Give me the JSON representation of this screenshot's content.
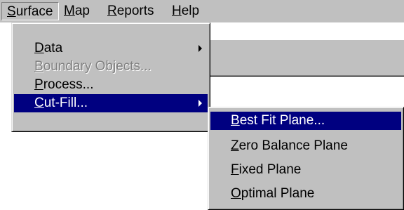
{
  "menubar": {
    "items": [
      {
        "accel": "S",
        "rest": "urface"
      },
      {
        "accel": "M",
        "rest": "ap"
      },
      {
        "accel": "R",
        "rest": "eports"
      },
      {
        "accel": "H",
        "rest": "elp"
      }
    ]
  },
  "surface_menu": {
    "items": [
      {
        "accel": "D",
        "rest": "ata",
        "has_submenu": true
      },
      {
        "accel": "B",
        "rest": "oundary Objects...",
        "disabled": true
      },
      {
        "accel": "P",
        "rest": "rocess..."
      },
      {
        "accel": "C",
        "rest": "ut-Fill...",
        "has_submenu": true,
        "highlighted": true
      }
    ]
  },
  "cutfill_submenu": {
    "items": [
      {
        "accel": "B",
        "rest": "est Fit Plane...",
        "highlighted": true
      },
      {
        "accel": "Z",
        "rest": "ero Balance Plane"
      },
      {
        "accel": "F",
        "rest": "ixed Plane"
      },
      {
        "accel": "O",
        "rest": "ptimal Plane"
      }
    ]
  },
  "colors": {
    "menu_face": "#c0c0c0",
    "highlight": "#000080",
    "disabled_text": "#808080"
  }
}
